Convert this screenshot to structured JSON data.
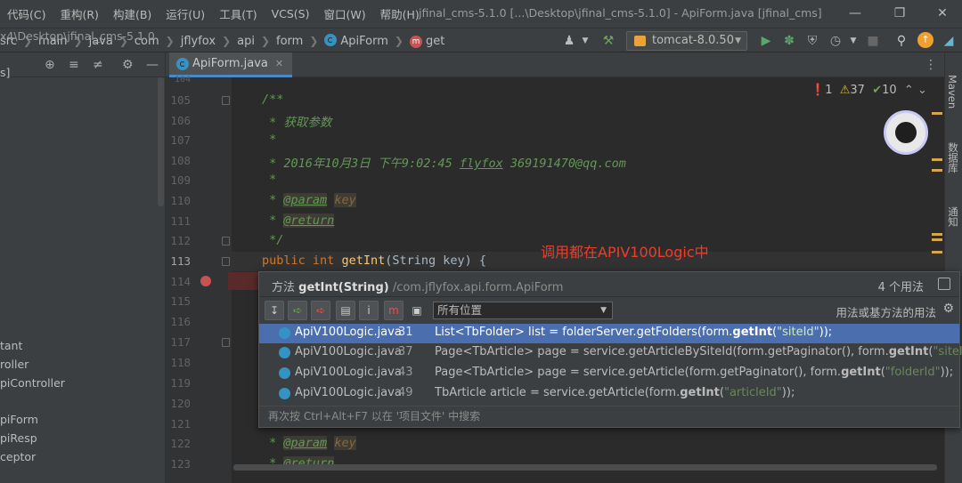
{
  "menu": {
    "items": [
      "代码(C)",
      "重构(R)",
      "构建(B)",
      "运行(U)",
      "工具(T)",
      "VCS(S)",
      "窗口(W)",
      "帮助(H)"
    ],
    "window_title": "jfinal_cms-5.1.0 [...\\Desktop\\jfinal_cms-5.1.0] - ApiForm.java [jfinal_cms]"
  },
  "nav": {
    "breadcrumb": [
      "src",
      "main",
      "java",
      "com",
      "jflyfox",
      "api",
      "form",
      "ApiForm",
      "get"
    ],
    "run_config": "tomcat-8.0.50"
  },
  "project": {
    "path": "x4\\Desktop\\jfinal_cms-5.1.0",
    "bracket": "s]",
    "tree": [
      "tant",
      "roller",
      "piController",
      "piForm",
      "piResp",
      "ceptor"
    ]
  },
  "editor": {
    "tab_label": "ApiForm.java",
    "line_numbers": [
      "104",
      "105",
      "106",
      "107",
      "108",
      "109",
      "110",
      "111",
      "112",
      "113",
      "114",
      "115",
      "116",
      "117",
      "118",
      "119",
      "120",
      "121",
      "122",
      "123"
    ],
    "code": {
      "l105": "/**",
      "l106": " * 获取参数",
      "l107": " *",
      "l108_a": " * 2016年10月3日 下午9:02:45 ",
      "l108_b": "flyfox",
      "l108_c": " 369191470@qq.com",
      "l109": " *",
      "l110_star": " * ",
      "l110_tag": "@param",
      "l110_val": "key",
      "l111_star": " * ",
      "l111_tag": "@return",
      "l112": " */",
      "l113_kw1": "public",
      "l113_kw2": "int",
      "l113_fn": "getInt",
      "l113_rest": "(String key) {",
      "l122_star": " * ",
      "l122_tag": "@param",
      "l122_val": "key",
      "l123_star": " * ",
      "l123_tag": "@return"
    },
    "annotation": "调用都在APIV100Logic中"
  },
  "inspections": {
    "errors": "1",
    "warnings": "37",
    "ok": "10"
  },
  "right_stripe": [
    "Maven",
    "数据库",
    "通知"
  ],
  "popup": {
    "title_prefix": "方法",
    "title_method": "getInt(String)",
    "title_pkg": "/com.jflyfox.api.form.ApiForm",
    "count": "4 个用法",
    "scope": "所有位置",
    "include_base": "用法或基方法的用法",
    "rows": [
      {
        "file": "ApiV100Logic.java",
        "line": "31",
        "pre": "List<TbFolder> list = folderServer.getFolders(form.",
        "hit": "getInt",
        "lp": "(",
        "str": "\"siteId\"",
        "post": "));"
      },
      {
        "file": "ApiV100Logic.java",
        "line": "37",
        "pre": "Page<TbArticle> page = service.getArticleBySiteId(form.getPaginator(), form.",
        "hit": "getInt",
        "lp": "(",
        "str": "\"siteId\"",
        "post": "));"
      },
      {
        "file": "ApiV100Logic.java",
        "line": "43",
        "pre": "Page<TbArticle> page = service.getArticle(form.getPaginator(), form.",
        "hit": "getInt",
        "lp": "(",
        "str": "\"folderId\"",
        "post": "));"
      },
      {
        "file": "ApiV100Logic.java",
        "line": "49",
        "pre": "TbArticle article = service.getArticle(form.",
        "hit": "getInt",
        "lp": "(",
        "str": "\"articleId\"",
        "post": "));"
      }
    ],
    "footer": "再次按 Ctrl+Alt+F7 以在 '项目文件' 中搜索"
  }
}
